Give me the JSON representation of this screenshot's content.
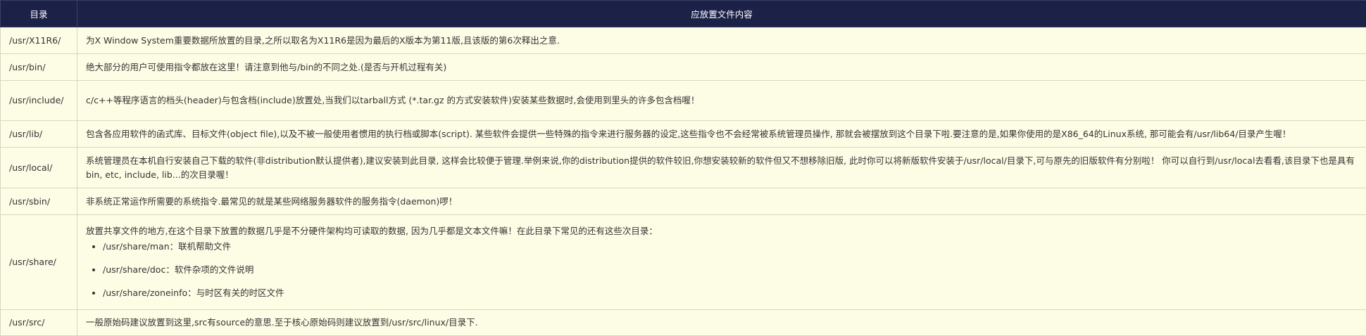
{
  "headers": {
    "dir": "目录",
    "content": "应放置文件内容"
  },
  "rows": [
    {
      "dir": "/usr/X11R6/",
      "text": "为X Window System重要数据所放置的目录,之所以取名为X11R6是因为最后的X版本为第11版,且该版的第6次释出之意."
    },
    {
      "dir": "/usr/bin/",
      "text": "绝大部分的用户可使用指令都放在这里！请注意到他与/bin的不同之处.(是否与开机过程有关)"
    },
    {
      "dir": "/usr/include/",
      "text": "c/c++等程序语言的档头(header)与包含档(include)放置处,当我们以tarball方式 (*.tar.gz 的方式安装软件)安装某些数据时,会使用到里头的许多包含档喔！"
    },
    {
      "dir": "/usr/lib/",
      "text": "包含各应用软件的函式库、目标文件(object file),以及不被一般使用者惯用的执行档或脚本(script). 某些软件会提供一些特殊的指令来进行服务器的设定,这些指令也不会经常被系统管理员操作, 那就会被摆放到这个目录下啦.要注意的是,如果你使用的是X86_64的Linux系统, 那可能会有/usr/lib64/目录产生喔！"
    },
    {
      "dir": "/usr/local/",
      "text": "系统管理员在本机自行安装自己下载的软件(非distribution默认提供者),建议安装到此目录, 这样会比较便于管理.举例来说,你的distribution提供的软件较旧,你想安装较新的软件但又不想移除旧版, 此时你可以将新版软件安装于/usr/local/目录下,可与原先的旧版软件有分别啦！ 你可以自行到/usr/local去看看,该目录下也是具有bin, etc, include, lib...的次目录喔！"
    },
    {
      "dir": "/usr/sbin/",
      "text": "非系统正常运作所需要的系统指令.最常见的就是某些网络服务器软件的服务指令(daemon)啰！"
    },
    {
      "dir": "/usr/share/",
      "text": "放置共享文件的地方,在这个目录下放置的数据几乎是不分硬件架构均可读取的数据, 因为几乎都是文本文件嘛！在此目录下常见的还有这些次目录：",
      "items": [
        "/usr/share/man：联机帮助文件",
        "/usr/share/doc：软件杂项的文件说明",
        "/usr/share/zoneinfo：与时区有关的时区文件"
      ]
    },
    {
      "dir": "/usr/src/",
      "text": "一般原始码建议放置到这里,src有source的意思.至于核心原始码则建议放置到/usr/src/linux/目录下."
    }
  ]
}
